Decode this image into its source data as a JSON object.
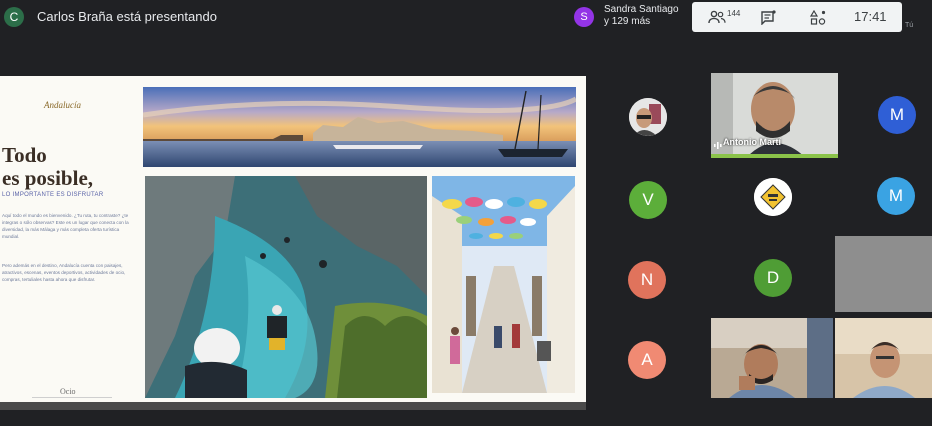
{
  "presenter": {
    "avatar_letter": "C",
    "status": "Carlos Braña está presentando"
  },
  "viewers": {
    "avatar_letter": "S",
    "name_line1": "Sandra Santiago",
    "name_line2": "y 129 más"
  },
  "toolbar": {
    "participants_count": "144",
    "participants_icon": "people-icon",
    "chat_icon": "chat-icon",
    "activities_icon": "shapes-icon",
    "clock": "17:41"
  },
  "you_label": "Tú",
  "slide": {
    "brand": "Andalucía",
    "headline_line1": "Todo",
    "headline_line2": "es posible,",
    "subhead": "LO IMPORTANTE ES DISFRUTAR",
    "paragraph1": "Aquí todo el mundo es bienvenido. ¿Tu ruta, tu contraste? ¿te integras o sólo observas? Este es un lugar que conecta con la diversidad, la más Málaga y más completa oferta turística mundial.",
    "paragraph2": "Pero además en el destino, Andalucía cuenta con paisajes, atractivos, escenas, eventos deportivos, actividades de ocio, compras, tertuliales hasta ahora que disfrutar.",
    "footer_logo": "Ocio"
  },
  "participants": {
    "active_speaker": "Antonio Martí",
    "circles": [
      {
        "letter": "M"
      },
      {
        "letter": "V"
      },
      {
        "letter": "M"
      },
      {
        "letter": "N"
      },
      {
        "letter": "D"
      },
      {
        "letter": "A"
      }
    ]
  },
  "colors": {
    "background": "#202124",
    "speaking_bar": "#8bc34a",
    "avatar_m1": "#2f5fd6",
    "avatar_v": "#5cae3a",
    "avatar_m2": "#3aa3e3",
    "avatar_n": "#e0735c",
    "avatar_d": "#4f9d35",
    "avatar_a": "#f08a73"
  }
}
